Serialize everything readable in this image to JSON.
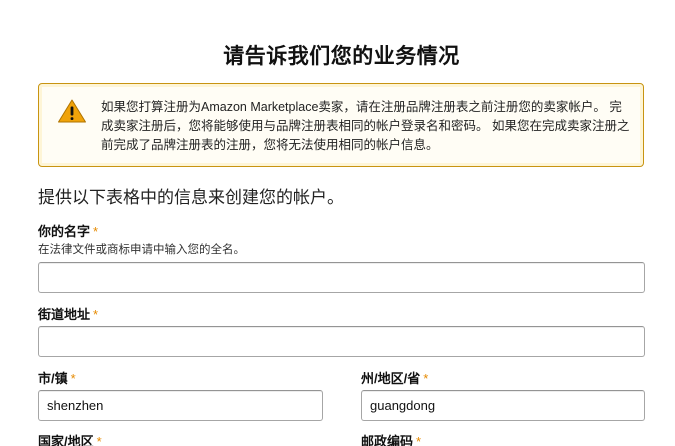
{
  "form": {
    "title": "请告诉我们您的业务情况",
    "alert": {
      "icon": "warning-icon",
      "text": "如果您打算注册为Amazon Marketplace卖家，请在注册品牌注册表之前注册您的卖家帐户。 完成卖家注册后，您将能够使用与品牌注册表相同的帐户登录名和密码。 如果您在完成卖家注册之前完成了品牌注册表的注册，您将无法使用相同的帐户信息。"
    },
    "section_heading": "提供以下表格中的信息来创建您的帐户。",
    "required_marker": "*",
    "fields": {
      "name": {
        "label": "你的名字",
        "hint": "在法律文件或商标申请中输入您的全名。",
        "value": ""
      },
      "street": {
        "label": "街道地址",
        "value": ""
      },
      "city": {
        "label": "市/镇",
        "value": "shenzhen"
      },
      "state": {
        "label": "州/地区/省",
        "value": "guangdong"
      },
      "country": {
        "label": "国家/地区"
      },
      "postal": {
        "label": "邮政编码"
      }
    },
    "colors": {
      "alert_border": "#c89411",
      "alert_icon": "#f0a30a",
      "required": "#e68a00"
    }
  }
}
